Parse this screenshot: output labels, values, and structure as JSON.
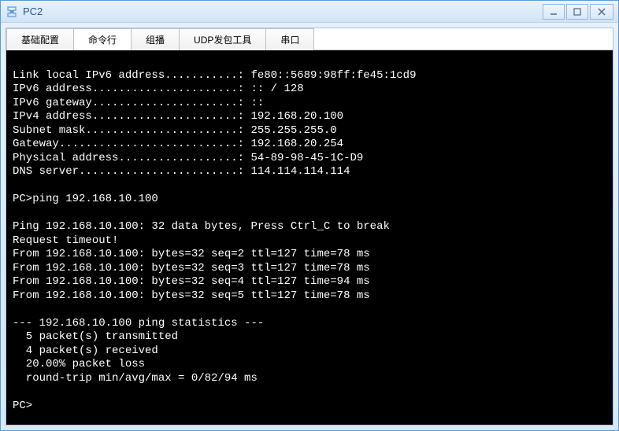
{
  "window": {
    "title": "PC2"
  },
  "tabs": {
    "items": [
      {
        "label": "基础配置"
      },
      {
        "label": "命令行"
      },
      {
        "label": "组播"
      },
      {
        "label": "UDP发包工具"
      },
      {
        "label": "串口"
      }
    ]
  },
  "terminal": {
    "output": "\nLink local IPv6 address...........: fe80::5689:98ff:fe45:1cd9\nIPv6 address......................: :: / 128\nIPv6 gateway......................: ::\nIPv4 address......................: 192.168.20.100\nSubnet mask.......................: 255.255.255.0\nGateway...........................: 192.168.20.254\nPhysical address..................: 54-89-98-45-1C-D9\nDNS server........................: 114.114.114.114\n\nPC>ping 192.168.10.100\n\nPing 192.168.10.100: 32 data bytes, Press Ctrl_C to break\nRequest timeout!\nFrom 192.168.10.100: bytes=32 seq=2 ttl=127 time=78 ms\nFrom 192.168.10.100: bytes=32 seq=3 ttl=127 time=78 ms\nFrom 192.168.10.100: bytes=32 seq=4 ttl=127 time=94 ms\nFrom 192.168.10.100: bytes=32 seq=5 ttl=127 time=78 ms\n\n--- 192.168.10.100 ping statistics ---\n  5 packet(s) transmitted\n  4 packet(s) received\n  20.00% packet loss\n  round-trip min/avg/max = 0/82/94 ms\n\nPC>"
  },
  "chart_data": {
    "type": "table",
    "network_config": {
      "link_local_ipv6": "fe80::5689:98ff:fe45:1cd9",
      "ipv6_address": ":: / 128",
      "ipv6_gateway": "::",
      "ipv4_address": "192.168.20.100",
      "subnet_mask": "255.255.255.0",
      "gateway": "192.168.20.254",
      "physical_address": "54-89-98-45-1C-D9",
      "dns_server": "114.114.114.114"
    },
    "ping": {
      "target": "192.168.10.100",
      "bytes": 32,
      "timeout_seq": [
        1
      ],
      "replies": [
        {
          "seq": 2,
          "bytes": 32,
          "ttl": 127,
          "time_ms": 78
        },
        {
          "seq": 3,
          "bytes": 32,
          "ttl": 127,
          "time_ms": 78
        },
        {
          "seq": 4,
          "bytes": 32,
          "ttl": 127,
          "time_ms": 94
        },
        {
          "seq": 5,
          "bytes": 32,
          "ttl": 127,
          "time_ms": 78
        }
      ],
      "stats": {
        "transmitted": 5,
        "received": 4,
        "loss_percent": 20.0,
        "rtt_min_ms": 0,
        "rtt_avg_ms": 82,
        "rtt_max_ms": 94
      }
    }
  }
}
